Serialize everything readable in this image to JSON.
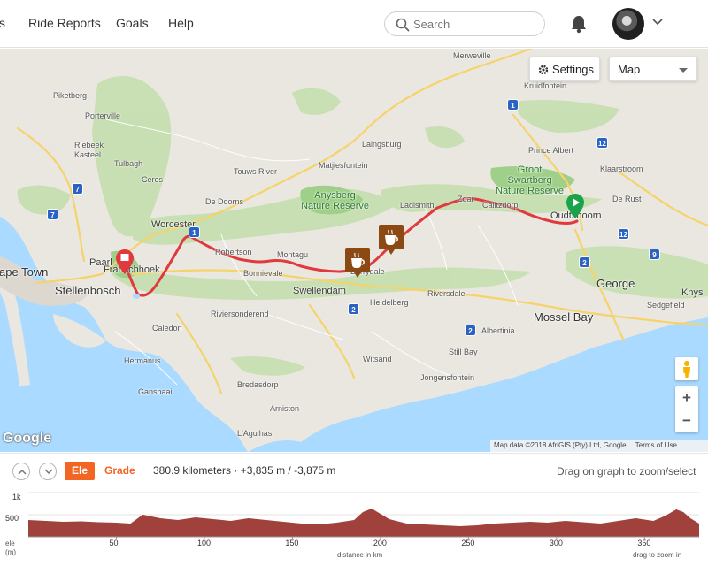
{
  "nav": {
    "items": [
      {
        "label": "s"
      },
      {
        "label": "Ride Reports"
      },
      {
        "label": "Goals"
      },
      {
        "label": "Help"
      }
    ],
    "search_placeholder": "Search",
    "icons": [
      "search-icon",
      "bell-icon",
      "chevron-down-icon"
    ]
  },
  "map": {
    "settings_label": "Settings",
    "map_type": "Map",
    "places": {
      "cape_town": "ape Town",
      "stellenbosch": "Stellenbosch",
      "paarl": "Paarl",
      "franschhoek": "Franschhoek",
      "worcester": "Worcester",
      "robertson": "Robertson",
      "montagu": "Montagu",
      "bonnievale": "Bonnievale",
      "swellendam": "Swellendam",
      "barrydale": "Barrydale",
      "ladismith": "Ladismith",
      "zoar": "Zoar",
      "calitzdorp": "Calitzdorp",
      "oudtshoorn": "Oudtshoorn",
      "george": "George",
      "mossel_bay": "Mossel Bay",
      "knysna": "Knys",
      "piketberg": "Piketberg",
      "porterville": "Porterville",
      "riebeek_kasteel": "Riebeek\nKasteel",
      "tulbagh": "Tulbagh",
      "ceres": "Ceres",
      "touws_river": "Touws River",
      "de_doorns": "De Doorns",
      "matjiesfontein": "Matjiesfontein",
      "laingsburg": "Laingsburg",
      "merweville": "Merweville",
      "kruidfontein": "Kruidfontein",
      "prince_albert": "Prince Albert",
      "klaarstroom": "Klaarstroom",
      "de_rust": "De Rust",
      "riviersonderend": "Riviersonderend",
      "caledon": "Caledon",
      "hermanus": "Hermanus",
      "gansbaai": "Gansbaai",
      "bredasdorp": "Bredasdorp",
      "arniston": "Arniston",
      "l_agulhas": "L'Agulhas",
      "heidelberg": "Heidelberg",
      "riversdale": "Riversdale",
      "albertinia": "Albertinia",
      "still_bay": "Still Bay",
      "witsand": "Witsand",
      "jongensfontein": "Jongensfontein",
      "sedgefield": "Sedgefield",
      "anysberg": "Anysberg\nNature Reserve",
      "groot_swartberg": "Groot\nSwartberg\nNature Reserve"
    },
    "route_shields": [
      "1",
      "7",
      "12",
      "2",
      "9",
      "2",
      "2",
      "1",
      "12",
      "7"
    ],
    "google_logo": "Google",
    "attribution": "Map data ©2018 AfriGIS (Pty) Ltd, Google",
    "terms": "Terms of Use",
    "zoom_in": "+",
    "zoom_out": "−",
    "route_color": "#e0393e",
    "start_marker_color": "#1aa34a",
    "end_marker_color": "#e0393e",
    "poi_color": "#8b4a14"
  },
  "profile": {
    "ele_label": "Ele",
    "grade_label": "Grade",
    "stats": "380.9 kilometers · +3,835 m / -3,875 m",
    "drag_hint": "Drag on graph to zoom/select",
    "y_ticks": [
      "1k",
      "500"
    ],
    "y_axis_label_1": "ele",
    "y_axis_label_2": "(m)",
    "x_ticks": [
      "50",
      "100",
      "150",
      "200",
      "250",
      "300",
      "350"
    ],
    "x_axis_label": "distance in km",
    "zoom_hint": "drag to zoom in",
    "fill_color": "#a0413c",
    "accent": "#f26522"
  },
  "chart_data": {
    "type": "area",
    "xlabel": "distance in km",
    "ylabel": "ele (m)",
    "ylim": [
      0,
      1000
    ],
    "xlim": [
      0,
      381
    ],
    "x": [
      0,
      10,
      20,
      30,
      40,
      50,
      58,
      65,
      75,
      85,
      95,
      105,
      115,
      125,
      135,
      145,
      155,
      165,
      175,
      185,
      190,
      195,
      200,
      205,
      215,
      225,
      235,
      245,
      255,
      265,
      275,
      285,
      295,
      305,
      315,
      325,
      335,
      345,
      355,
      362,
      368,
      372,
      376,
      381
    ],
    "y": [
      380,
      360,
      340,
      350,
      330,
      320,
      300,
      500,
      420,
      380,
      440,
      400,
      360,
      420,
      380,
      340,
      300,
      280,
      320,
      380,
      560,
      640,
      520,
      400,
      300,
      280,
      260,
      240,
      260,
      300,
      320,
      340,
      320,
      360,
      330,
      300,
      360,
      420,
      360,
      480,
      620,
      560,
      420,
      300
    ]
  }
}
